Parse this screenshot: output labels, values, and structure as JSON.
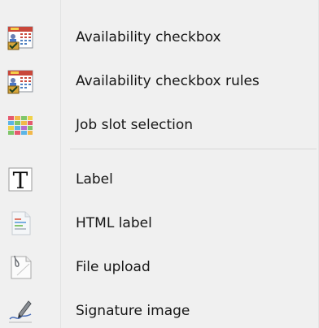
{
  "menu": {
    "items": [
      {
        "label": "Availability checkbox",
        "icon": "availability-calendar-icon"
      },
      {
        "label": "Availability checkbox rules",
        "icon": "availability-rules-icon"
      },
      {
        "label": "Job slot selection",
        "icon": "job-slot-grid-icon"
      },
      {
        "label": "Label",
        "icon": "text-label-icon"
      },
      {
        "label": "HTML label",
        "icon": "html-label-icon"
      },
      {
        "label": "File upload",
        "icon": "file-upload-icon"
      },
      {
        "label": "Signature image",
        "icon": "signature-pen-icon"
      }
    ]
  }
}
